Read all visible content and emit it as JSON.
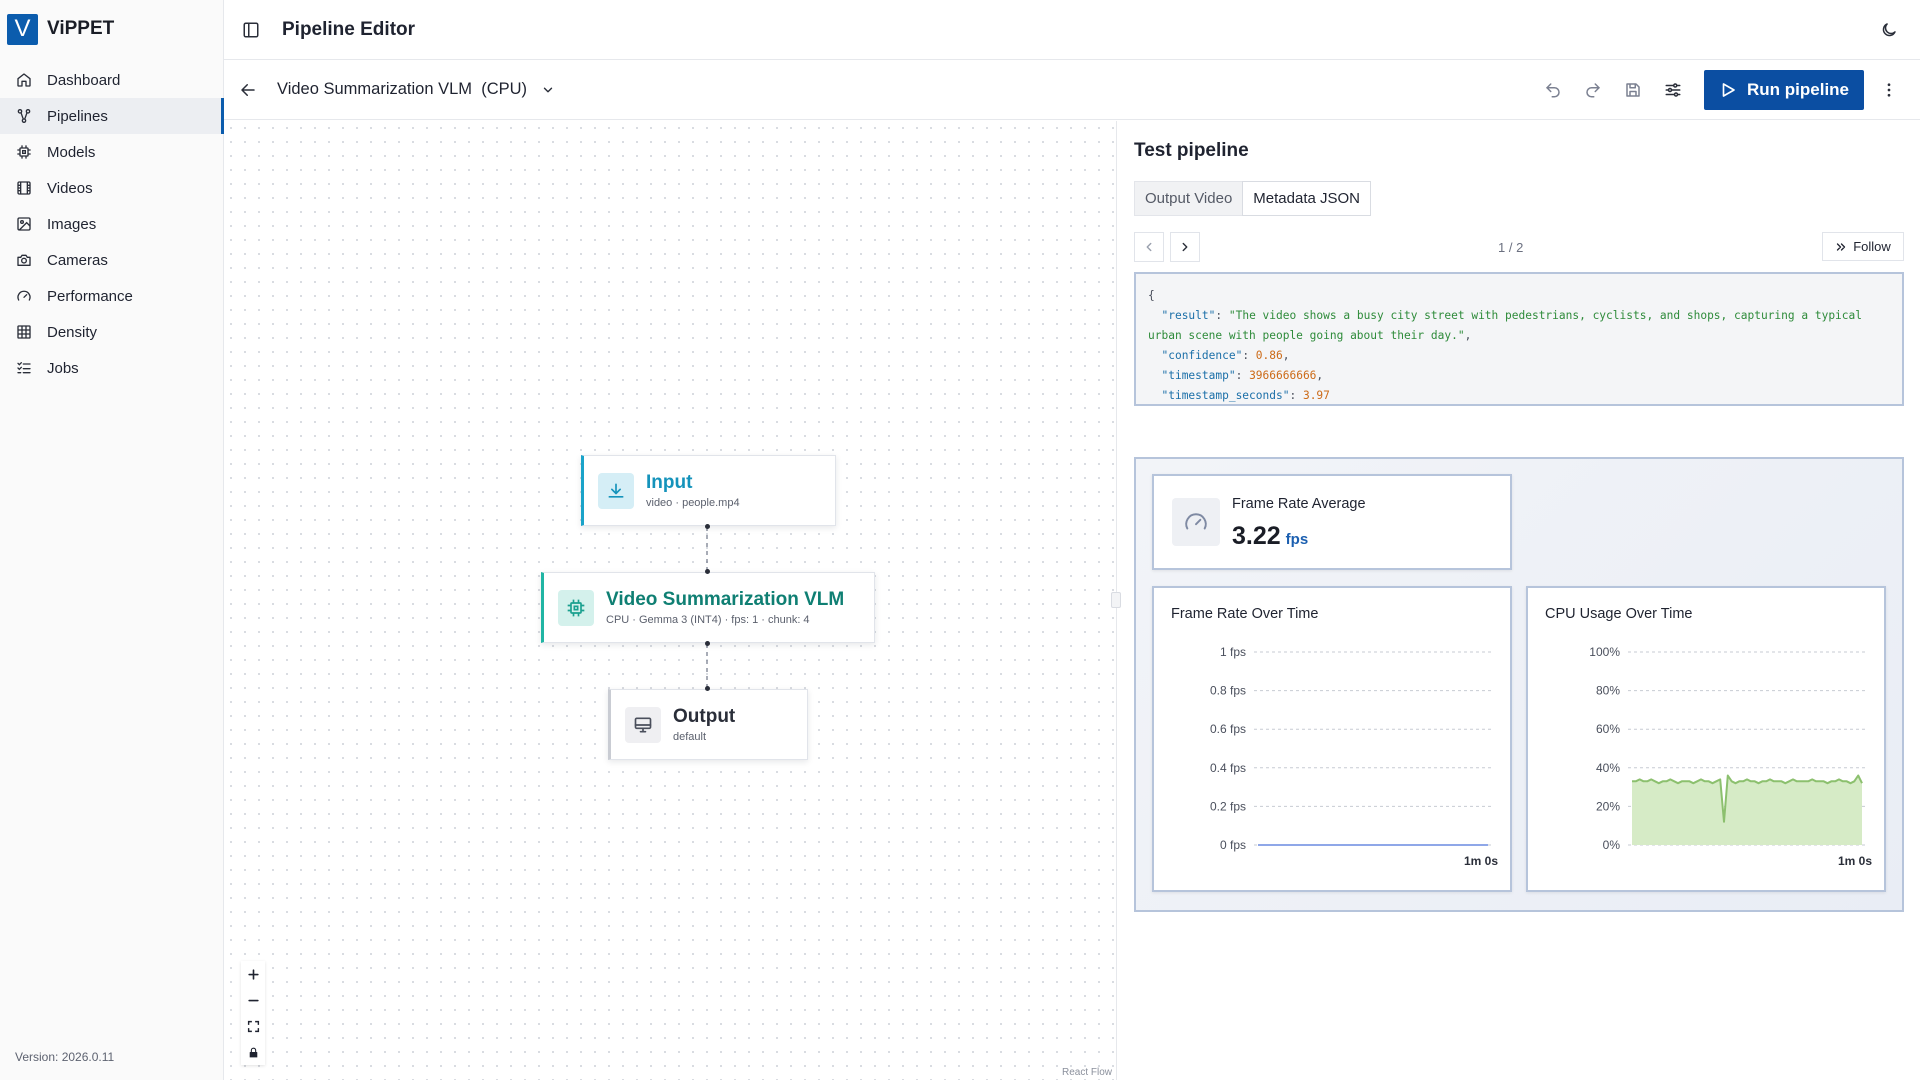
{
  "app": {
    "name": "ViPPET",
    "logo_letter": "V",
    "version": "Version: 2026.0.11"
  },
  "sidebar": {
    "items": [
      {
        "label": "Dashboard",
        "icon": "home-icon",
        "active": false
      },
      {
        "label": "Pipelines",
        "icon": "pipelines-icon",
        "active": true
      },
      {
        "label": "Models",
        "icon": "chip-icon",
        "active": false
      },
      {
        "label": "Videos",
        "icon": "film-icon",
        "active": false
      },
      {
        "label": "Images",
        "icon": "image-icon",
        "active": false
      },
      {
        "label": "Cameras",
        "icon": "camera-icon",
        "active": false
      },
      {
        "label": "Performance",
        "icon": "gauge-icon",
        "active": false
      },
      {
        "label": "Density",
        "icon": "grid-icon",
        "active": false
      },
      {
        "label": "Jobs",
        "icon": "list-checks-icon",
        "active": false
      }
    ]
  },
  "header": {
    "title": "Pipeline Editor"
  },
  "subheader": {
    "pipeline_name": "Video Summarization VLM  (CPU)",
    "run_label": "Run pipeline"
  },
  "canvas": {
    "nodes": {
      "input": {
        "title": "Input",
        "subtitle": "video · people.mp4"
      },
      "vlm": {
        "title": "Video Summarization VLM",
        "subtitle": "CPU · Gemma 3 (INT4) · fps: 1 · chunk: 4"
      },
      "output": {
        "title": "Output",
        "subtitle": "default"
      }
    },
    "attribution": "React Flow"
  },
  "test_panel": {
    "title": "Test pipeline",
    "tabs": [
      {
        "label": "Output Video",
        "active": false
      },
      {
        "label": "Metadata JSON",
        "active": true
      }
    ],
    "pager": {
      "count": "1 / 2",
      "follow_label": "Follow"
    },
    "json": {
      "result_key": "\"result\"",
      "result_value": "\"The video shows a busy city street with pedestrians, cyclists, and shops, capturing a typical urban scene with people going about their day.\"",
      "confidence_key": "\"confidence\"",
      "confidence_value": "0.86",
      "timestamp_key": "\"timestamp\"",
      "timestamp_value": "3966666666",
      "timestamp_seconds_key": "\"timestamp_seconds\"",
      "timestamp_seconds_value": "3.97"
    },
    "metrics": {
      "frame_rate_avg_label": "Frame Rate Average",
      "frame_rate_avg_value": "3.22",
      "frame_rate_avg_unit": "fps",
      "frame_rate_chart_title": "Frame Rate Over Time",
      "cpu_chart_title": "CPU Usage Over Time"
    }
  },
  "chart_data": [
    {
      "type": "line",
      "title": "Frame Rate Over Time",
      "y_ticks": [
        "0 fps",
        "0.2 fps",
        "0.4 fps",
        "0.6 fps",
        "0.8 fps",
        "1 fps"
      ],
      "ylim": [
        0,
        1
      ],
      "x_label_end": "1m 0s",
      "x": [
        0,
        1
      ],
      "series": [
        {
          "values": [
            0,
            0
          ]
        }
      ],
      "color": "#8fa7e8",
      "grid": true
    },
    {
      "type": "area",
      "title": "CPU Usage Over Time",
      "y_ticks": [
        "0%",
        "20%",
        "40%",
        "60%",
        "80%",
        "100%"
      ],
      "ylim": [
        0,
        100
      ],
      "x_label_end": "1m 0s",
      "x": [
        0,
        1,
        2,
        3,
        4,
        5,
        6,
        7,
        8,
        9,
        10,
        11,
        12,
        13,
        14,
        15,
        16,
        17,
        18,
        19,
        20,
        21,
        22,
        23,
        24,
        25,
        26,
        27,
        28,
        29,
        30,
        31,
        32,
        33,
        34,
        35,
        36,
        37,
        38,
        39,
        40,
        41,
        42,
        43,
        44,
        45,
        46,
        47,
        48,
        49,
        50,
        51,
        52,
        53,
        54,
        55,
        56,
        57,
        58,
        59,
        60
      ],
      "series": [
        {
          "values": [
            33,
            33,
            34,
            33,
            33,
            34,
            33,
            32,
            33,
            33,
            34,
            33,
            32,
            33,
            33,
            33,
            32,
            33,
            34,
            33,
            33,
            32,
            33,
            34,
            12,
            36,
            33,
            32,
            33,
            33,
            34,
            33,
            33,
            32,
            33,
            33,
            34,
            33,
            33,
            33,
            32,
            33,
            34,
            33,
            33,
            33,
            33,
            34,
            33,
            33,
            33,
            32,
            33,
            33,
            34,
            33,
            33,
            32,
            33,
            36,
            32
          ]
        }
      ],
      "color": "#8cc06e",
      "fill": "#d6ebc6",
      "grid": true
    }
  ]
}
